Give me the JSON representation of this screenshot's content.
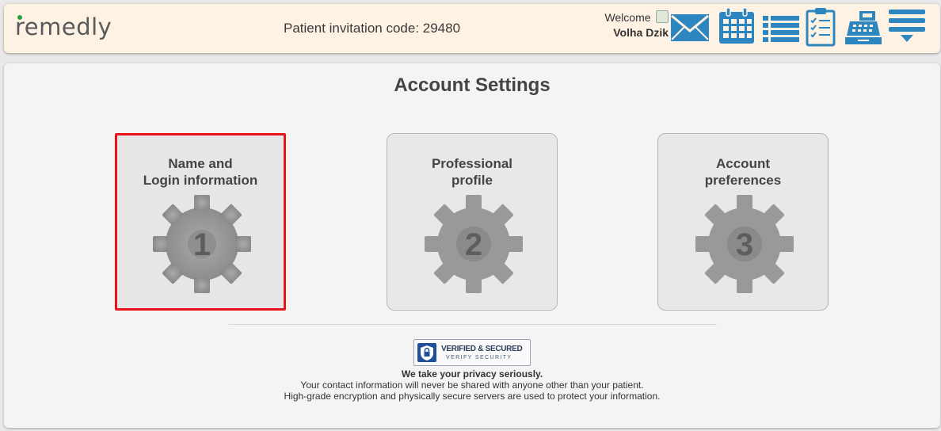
{
  "header": {
    "logo": "remedly",
    "invitation_text": "Patient invitation code: 29480",
    "welcome_label": "Welcome",
    "user_name": "Volha Dzik",
    "icons": [
      "mail-icon",
      "calendar-icon",
      "list-icon",
      "checklist-icon",
      "cash-register-icon",
      "menu-icon"
    ],
    "accent_color": "#2e86c1"
  },
  "main": {
    "title": "Account Settings",
    "cards": [
      {
        "title_line1": "Name and",
        "title_line2": "Login information",
        "number": "1",
        "selected": true
      },
      {
        "title_line1": "Professional",
        "title_line2": "profile",
        "number": "2",
        "selected": false
      },
      {
        "title_line1": "Account",
        "title_line2": "preferences",
        "number": "3",
        "selected": false
      }
    ],
    "badge": {
      "main": "VERIFIED & SECURED",
      "sub": "VERIFY SECURITY"
    },
    "privacy": {
      "heading": "We take your privacy seriously.",
      "line1": "Your contact information will never be shared with anyone other than your patient.",
      "line2": "High-grade encryption and physically secure servers are used to protect your information."
    },
    "selected_border_color": "#e8141c"
  }
}
